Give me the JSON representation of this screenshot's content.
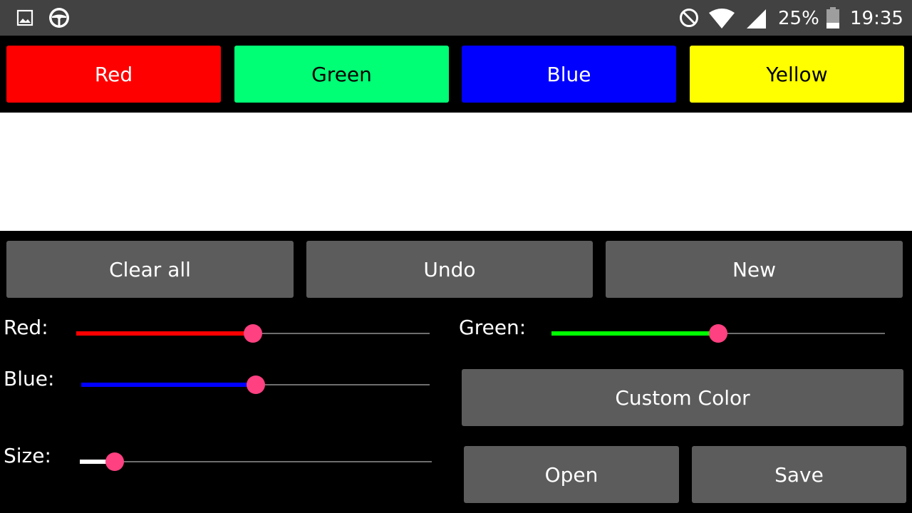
{
  "status_bar": {
    "battery_percent": "25%",
    "time": "19:35",
    "icons": [
      "image-icon",
      "steering-wheel-icon",
      "do-not-disturb-icon",
      "wifi-icon",
      "signal-icon",
      "battery-icon"
    ]
  },
  "presets": [
    {
      "label": "Red",
      "bg": "#ff0000",
      "fg": "#ffffff"
    },
    {
      "label": "Green",
      "bg": "#00ff75",
      "fg": "#000000"
    },
    {
      "label": "Blue",
      "bg": "#0000ff",
      "fg": "#ffffff"
    },
    {
      "label": "Yellow",
      "bg": "#ffff00",
      "fg": "#000000"
    }
  ],
  "actions": {
    "clear_all": "Clear all",
    "undo": "Undo",
    "new": "New",
    "custom_color": "Custom Color",
    "open": "Open",
    "save": "Save"
  },
  "sliders": {
    "red": {
      "label": "Red:",
      "value": 0.5,
      "color": "#ff0000"
    },
    "green": {
      "label": "Green:",
      "value": 0.5,
      "color": "#00ff00"
    },
    "blue": {
      "label": "Blue:",
      "value": 0.5,
      "color": "#0000ff"
    },
    "size": {
      "label": "Size:",
      "value": 0.1,
      "color": "#ffffff"
    }
  },
  "theme": {
    "accent": "#ff4081",
    "button_bg": "#5c5c5d",
    "status_bar_bg": "#424242"
  }
}
